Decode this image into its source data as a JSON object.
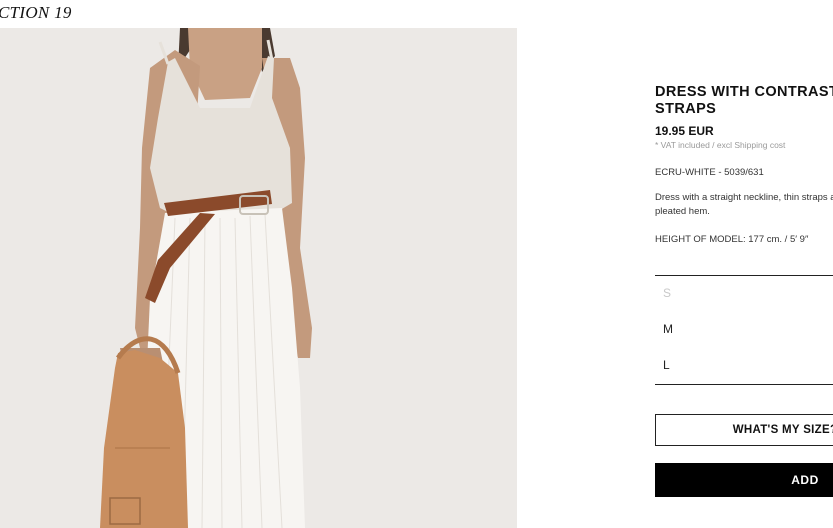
{
  "collection_label": "CTION 19",
  "product": {
    "title": "DRESS WITH CONTRASTING STRAPS",
    "price": "19.95 EUR",
    "vat_note": "* VAT included / excl Shipping cost",
    "color_ref": "ECRU-WHITE - 5039/631",
    "description": "Dress with a straight neckline, thin straps and a pleated hem.",
    "model_height": "HEIGHT OF MODEL: 177 cm. / 5′ 9″"
  },
  "sizes": [
    {
      "label": "S",
      "available": false
    },
    {
      "label": "M",
      "available": true
    },
    {
      "label": "L",
      "available": true
    }
  ],
  "buttons": {
    "whats_my_size": "WHAT'S MY SIZE?",
    "add": "ADD"
  },
  "colors": {
    "background": "#ffffff",
    "photo_background": "#ece9e6",
    "dress_top": "#e6e1da",
    "skirt": "#f7f5f2",
    "belt": "#8b4a2b",
    "bag": "#c98e5f",
    "add_button": "#000000"
  }
}
